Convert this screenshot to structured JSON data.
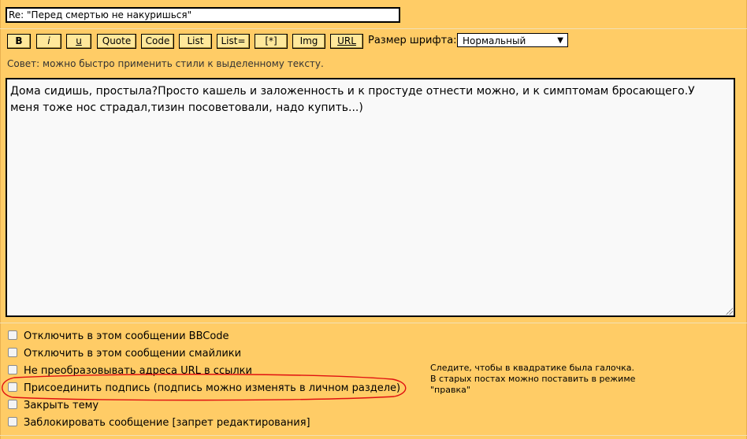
{
  "subject": {
    "value": "Re: \"Перед смертью не накуришься\""
  },
  "toolbar": {
    "buttons": [
      "B",
      "i",
      "u",
      "Quote",
      "Code",
      "List",
      "List=",
      "[*]",
      "Img",
      "URL"
    ],
    "font_size_label": "Размер шрифта:",
    "font_size_value": "Нормальный"
  },
  "tip": "Совет: можно быстро применить стили к выделенному тексту.",
  "message": {
    "text": "Дома сидишь, простыла?Просто кашель и заложенность и к простуде отнести можно, и к симптомам бросающего.У меня тоже нос страдал,тизин посоветовали, надо купить...)"
  },
  "options": [
    "Отключить в этом сообщении BBCode",
    "Отключить в этом сообщении смайлики",
    "Не преобразовывать адреса URL в ссылки",
    "Присоединить подпись (подпись можно изменять в личном разделе)",
    "Закрыть тему",
    "Заблокировать сообщение [запрет редактирования]"
  ],
  "hint": {
    "line1": "Следите, чтобы в квадратике была галочка.",
    "line2": "В старых постах можно поставить в режиме",
    "line3": "\"правка\""
  },
  "annotation_color": "#e01010"
}
